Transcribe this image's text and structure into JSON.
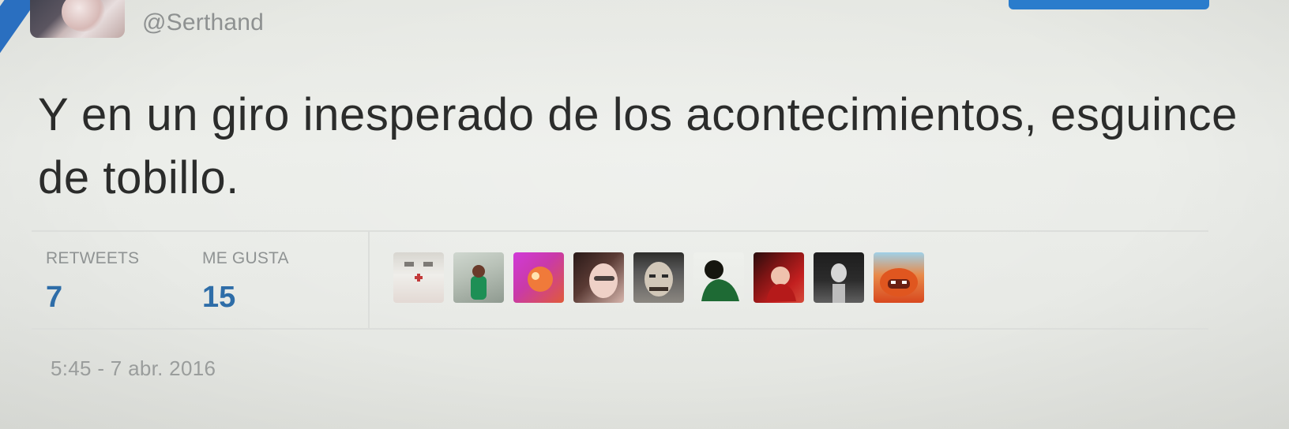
{
  "tweet": {
    "handle": "@Serthand",
    "text": "Y en un giro inesperado de los acontecimientos, esguince de tobillo.",
    "timestamp": "5:45 - 7 abr. 2016"
  },
  "stats": {
    "retweets_label": "RETWEETS",
    "retweets_value": "7",
    "likes_label": "ME GUSTA",
    "likes_value": "15"
  },
  "likers": {
    "count_shown": 9
  },
  "colors": {
    "accent": "#2e6da8",
    "button": "#2a7ccc",
    "text": "#2b2c2b",
    "muted": "#8f9393"
  }
}
